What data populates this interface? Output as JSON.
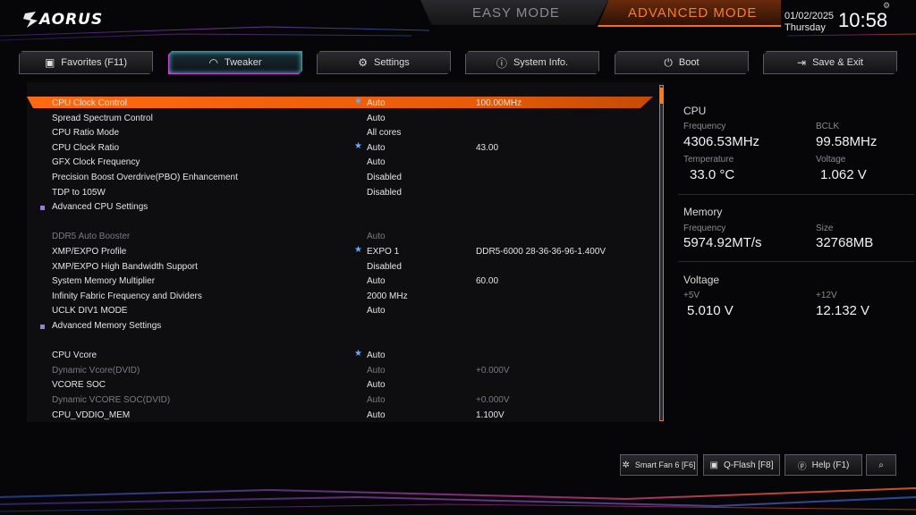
{
  "header": {
    "logo_text": "AORUS",
    "easy_mode_label": "EASY MODE",
    "advanced_mode_label": "ADVANCED MODE",
    "date": "01/02/2025",
    "weekday": "Thursday",
    "time": "10:58"
  },
  "tabs": [
    {
      "label": "Favorites (F11)",
      "icon": "favorites-icon"
    },
    {
      "label": "Tweaker",
      "icon": "speedometer-icon"
    },
    {
      "label": "Settings",
      "icon": "gear-icon"
    },
    {
      "label": "System Info.",
      "icon": "info-icon"
    },
    {
      "label": "Boot",
      "icon": "power-icon"
    },
    {
      "label": "Save & Exit",
      "icon": "exit-icon"
    }
  ],
  "settings": [
    {
      "label": "CPU Clock Control",
      "value": "Auto",
      "value2": "100.00MHz",
      "star": true,
      "selected": true
    },
    {
      "label": "Spread Spectrum Control",
      "value": "Auto",
      "value2": ""
    },
    {
      "label": "CPU Ratio Mode",
      "value": "All cores",
      "value2": ""
    },
    {
      "label": "CPU Clock Ratio",
      "value": "Auto",
      "value2": "43.00",
      "star": true
    },
    {
      "label": "GFX Clock Frequency",
      "value": "Auto",
      "value2": ""
    },
    {
      "label": "Precision Boost Overdrive(PBO) Enhancement",
      "value": "Disabled",
      "value2": ""
    },
    {
      "label": "TDP to 105W",
      "value": "Disabled",
      "value2": ""
    },
    {
      "label": "Advanced CPU Settings",
      "value": "",
      "value2": "",
      "submenu": true
    },
    {
      "label": "",
      "value": "",
      "value2": "",
      "spacer": true
    },
    {
      "label": "DDR5 Auto Booster",
      "value": "Auto",
      "value2": "",
      "dim": true
    },
    {
      "label": "XMP/EXPO Profile",
      "value": "EXPO 1",
      "value2": "DDR5-6000 28-36-36-96-1.400V",
      "star": true
    },
    {
      "label": "XMP/EXPO High Bandwidth Support",
      "value": "Disabled",
      "value2": ""
    },
    {
      "label": "System Memory Multiplier",
      "value": "Auto",
      "value2": "60.00"
    },
    {
      "label": "Infinity Fabric Frequency and Dividers",
      "value": "2000 MHz",
      "value2": ""
    },
    {
      "label": "UCLK DIV1 MODE",
      "value": "Auto",
      "value2": ""
    },
    {
      "label": "Advanced Memory Settings",
      "value": "",
      "value2": "",
      "submenu": true
    },
    {
      "label": "",
      "value": "",
      "value2": "",
      "spacer": true
    },
    {
      "label": "CPU Vcore",
      "value": "Auto",
      "value2": "",
      "star": true
    },
    {
      "label": "Dynamic Vcore(DVID)",
      "value": "Auto",
      "value2": "+0.000V",
      "dim": true
    },
    {
      "label": "VCORE SOC",
      "value": "Auto",
      "value2": ""
    },
    {
      "label": "Dynamic VCORE SOC(DVID)",
      "value": "Auto",
      "value2": "+0.000V",
      "dim": true
    },
    {
      "label": "CPU_VDDIO_MEM",
      "value": "Auto",
      "value2": "1.100V"
    }
  ],
  "monitor": {
    "cpu": {
      "title": "CPU",
      "freq_label": "Frequency",
      "freq": "4306.53MHz",
      "bclk_label": "BCLK",
      "bclk": "99.58MHz",
      "temp_label": "Temperature",
      "temp": "33.0 °C",
      "volt_label": "Voltage",
      "volt": "1.062 V"
    },
    "memory": {
      "title": "Memory",
      "freq_label": "Frequency",
      "freq": "5974.92MT/s",
      "size_label": "Size",
      "size": "32768MB"
    },
    "voltage": {
      "title": "Voltage",
      "v5_label": "+5V",
      "v5": "5.010 V",
      "v12_label": "+12V",
      "v12": "12.132 V"
    }
  },
  "bottom": {
    "smart_fan": "Smart Fan 6 [F6]",
    "qflash": "Q-Flash [F8]",
    "help": "Help (F1)"
  },
  "colors": {
    "accent": "#ff6a1a",
    "tab_active_border": "#d03fd8",
    "star": "#6aa8ff"
  }
}
